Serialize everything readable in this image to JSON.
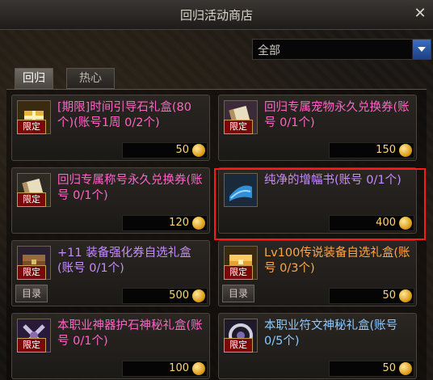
{
  "window": {
    "title": "回归活动商店"
  },
  "filter": {
    "value": "全部"
  },
  "tabs": [
    {
      "label": "回归",
      "active": true
    },
    {
      "label": "热心",
      "active": false
    }
  ],
  "items": [
    {
      "name": "[期限]时间引导石礼盒(80个)(账号1周 0/2个)",
      "price": "50",
      "badge": "限定",
      "color": "pink",
      "icon": "gift-box-icon",
      "has_catalog": false
    },
    {
      "name": "回归专属宠物永久兑换券(账号 0/1个)",
      "price": "150",
      "badge": "限定",
      "color": "pink",
      "icon": "scroll-icon",
      "has_catalog": false
    },
    {
      "name": "回归专属称号永久兑换券(账号 0/1个)",
      "price": "120",
      "badge": "限定",
      "color": "pink",
      "icon": "scroll-icon",
      "has_catalog": false
    },
    {
      "name": "纯净的增幅书(账号 0/1个)",
      "price": "400",
      "badge": "",
      "color": "purple",
      "icon": "book-icon",
      "has_catalog": false
    },
    {
      "name": "+11 装备强化券自选礼盒(账号 0/1个)",
      "price": "500",
      "badge": "限定",
      "color": "purple",
      "icon": "chest-icon",
      "has_catalog": true,
      "catalog_label": "目录"
    },
    {
      "name": "Lv100传说装备自选礼盒(账号 0/3个)",
      "price": "50",
      "badge": "限定",
      "color": "orange",
      "icon": "gold-chest-icon",
      "has_catalog": true,
      "catalog_label": "目录"
    },
    {
      "name": "本职业神器护石神秘礼盒(账号 0/1个)",
      "price": "100",
      "badge": "限定",
      "color": "pink",
      "icon": "crossed-blades-icon",
      "has_catalog": false
    },
    {
      "name": "本职业符文神秘礼盒(账号 0/5个)",
      "price": "50",
      "badge": "限定",
      "color": "blue",
      "icon": "rune-icon",
      "has_catalog": false
    }
  ],
  "colors": {
    "selected_border": "#ff1a1a",
    "price_text": "#ffd66b"
  }
}
